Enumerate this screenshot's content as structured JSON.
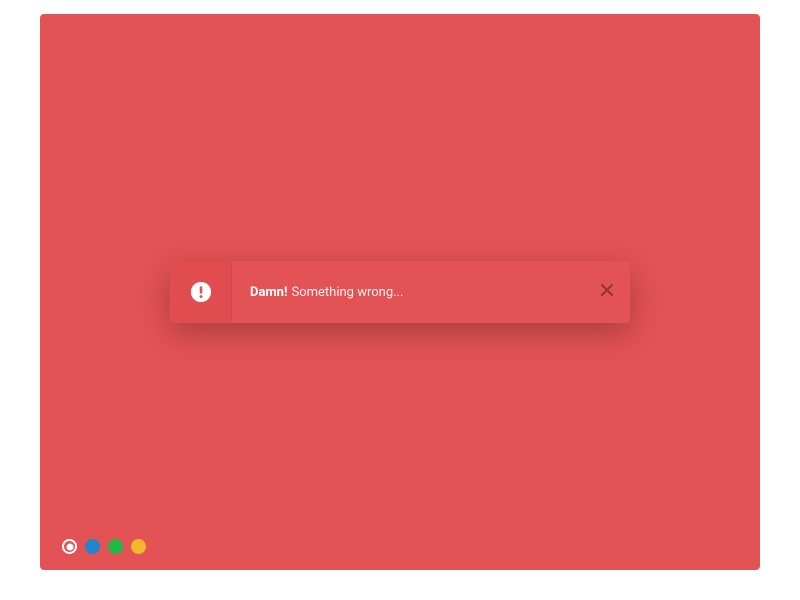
{
  "theme": {
    "bg": "#E35254",
    "alert_icon_bg": "#E14C4E",
    "alert_body_bg": "#E35254",
    "icon_glyph_color": "#E35254",
    "close_color": "#000000"
  },
  "alert": {
    "title": "Damn!",
    "text": "Something wrong..."
  },
  "dots": [
    {
      "id": "red",
      "color": "#E35254",
      "selected": true
    },
    {
      "id": "blue",
      "color": "#2185D0",
      "selected": false
    },
    {
      "id": "green",
      "color": "#21BA45",
      "selected": false
    },
    {
      "id": "yellow",
      "color": "#F2B82B",
      "selected": false
    }
  ]
}
